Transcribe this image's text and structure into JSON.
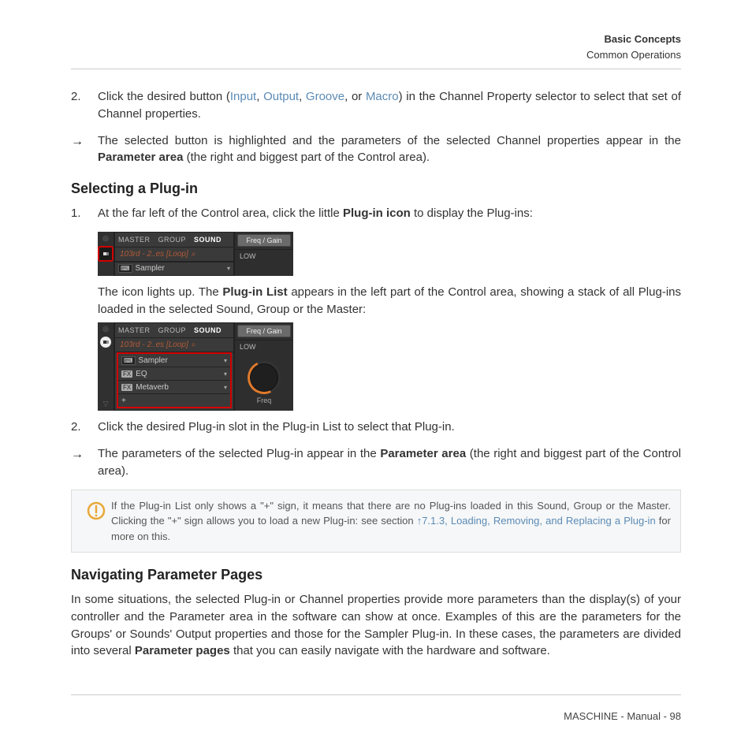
{
  "header": {
    "section": "Basic Concepts",
    "subsection": "Common Operations"
  },
  "footer": {
    "text": "MASCHINE - Manual - 98"
  },
  "step2_num": "2.",
  "step2_pre": "Click the desired button (",
  "link_input": "Input",
  "link_output": "Output",
  "link_groove": "Groove",
  "link_macro": "Macro",
  "step2_post": ") in the Channel Property selector to select that set of Channel properties.",
  "arrow1_pre": "The selected button is highlighted and the parameters of the selected Channel properties appear in the ",
  "param_area": "Parameter area",
  "arrow1_post": " (the right and biggest part of the Control area).",
  "h3_select": "Selecting a Plug-in",
  "sel_step1_num": "1.",
  "sel_step1_pre": "At the far left of the Control area, click the little ",
  "plugin_icon": "Plug-in icon",
  "sel_step1_post": " to display the Plug-ins:",
  "sel_after1_pre": "The icon lights up. The ",
  "plugin_list": "Plug-in List",
  "sel_after1_post": " appears in the left part of the Control area, showing a stack of all Plug-ins loaded in the selected Sound, Group or the Master:",
  "sel_step2_num": "2.",
  "sel_step2_text": "Click the desired Plug-in slot in the Plug-in List to select that Plug-in.",
  "arrow2_pre": "The parameters of the selected Plug-in appear in the ",
  "arrow2_post": " (the right and biggest part of the Control area).",
  "note_pre": "If the Plug-in List only shows a \"+\" sign, it means that there are no Plug-ins loaded in this Sound, Group or the Master. Clicking the \"+\" sign allows you to load a new Plug-in: see section ",
  "note_link": "↑7.1.3, Loading, Removing, and Replacing a Plug-in",
  "note_post": " for more on this.",
  "h3_nav": "Navigating Parameter Pages",
  "nav_para_pre": "In some situations, the selected Plug-in or Channel properties provide more parameters than the display(s) of your controller and the Parameter area in the software can show at once. Examples of this are the parameters for the Groups' or Sounds' Output properties and those for the Sampler Plug-in. In these cases, the parameters are divided into several ",
  "param_pages": "Parameter pages",
  "nav_para_post": " that you can easily navigate with the hardware and software.",
  "ui": {
    "tabs": {
      "master": "MASTER",
      "group": "GROUP",
      "sound": "SOUND"
    },
    "slot_name": "103rd - 2..es [Loop]",
    "sampler": "Sampler",
    "eq": "EQ",
    "metaverb": "Metaverb",
    "plus": "+",
    "freqgain": "Freq / Gain",
    "low": "LOW",
    "freq": "Freq",
    "fx": "FX"
  },
  "sep": ", ",
  "or": ", or ",
  "arrow_glyph": "→"
}
